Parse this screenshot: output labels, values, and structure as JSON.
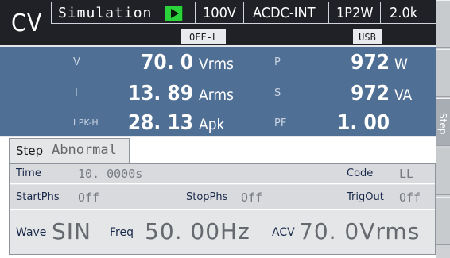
{
  "header": {
    "mode": "CV",
    "title": "Simulation",
    "voltage_range": "100V",
    "coupling": "ACDC-INT",
    "wiring": "1P2W",
    "power": "2.0k",
    "output_tag": "OFF-L",
    "interface_tag": "USB"
  },
  "measurements": {
    "v": {
      "label": "V",
      "value": "70. 0",
      "unit": "Vrms"
    },
    "i": {
      "label": "I",
      "value": "13. 89",
      "unit": "Arms"
    },
    "ipk": {
      "label": "I PK-H",
      "value": "28. 13",
      "unit": "Apk"
    },
    "p": {
      "label": "P",
      "value": "972",
      "unit": "W"
    },
    "s": {
      "label": "S",
      "value": "972",
      "unit": "VA"
    },
    "pf": {
      "label": "PF",
      "value": "1. 00",
      "unit": ""
    }
  },
  "step": {
    "tab_label": "Step",
    "tab_value": "Abnormal",
    "time_label": "Time",
    "time_value": "10. 0000s",
    "code_label": "Code",
    "code_value": "LL",
    "startphs_label": "StartPhs",
    "startphs_value": "Off",
    "stopphs_label": "StopPhs",
    "stopphs_value": "Off",
    "trigout_label": "TrigOut",
    "trigout_value": "Off",
    "wave_label": "Wave",
    "wave_value": "SIN",
    "freq_label": "Freq",
    "freq_value": "50. 00Hz",
    "acv_label": "ACV",
    "acv_value": "70. 0Vrms"
  },
  "softkeys": {
    "step_label": "Step"
  },
  "colors": {
    "header_bg": "#1f2126",
    "measure_bg": "#4f6f94",
    "run_indicator": "#2ad33a",
    "panel_bg": "#e5e6e8"
  }
}
